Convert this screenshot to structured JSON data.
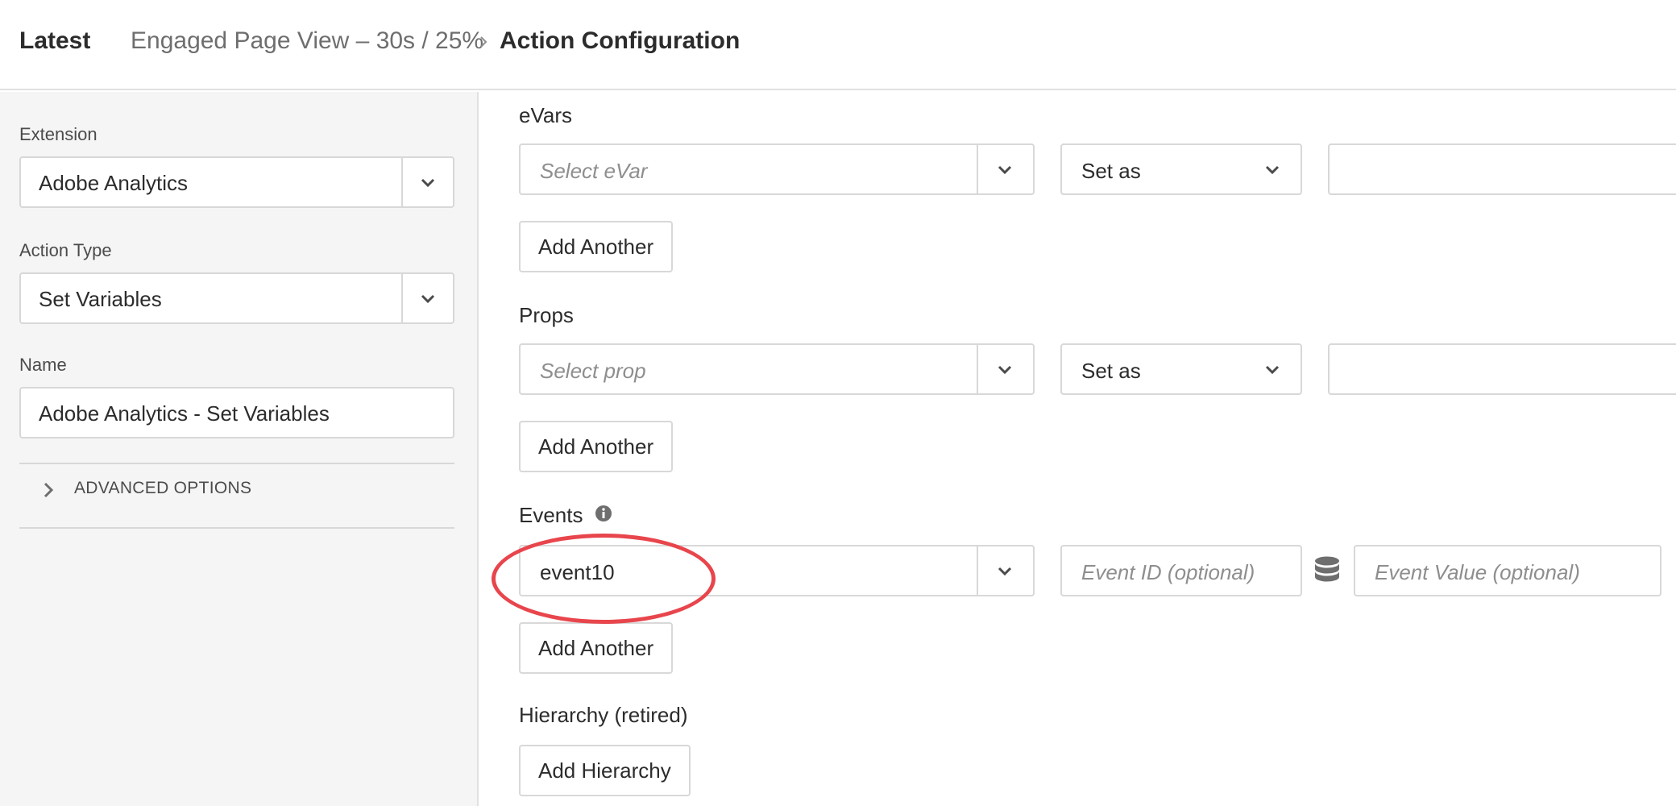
{
  "header": {
    "latest_label": "Latest",
    "breadcrumb_parent": "Engaged Page View – 30s / 25%",
    "breadcrumb_current": "Action Configuration"
  },
  "sidebar": {
    "extension_label": "Extension",
    "extension_value": "Adobe Analytics",
    "action_type_label": "Action Type",
    "action_type_value": "Set Variables",
    "name_label": "Name",
    "name_value": "Adobe Analytics - Set Variables",
    "advanced_options_label": "ADVANCED OPTIONS"
  },
  "main": {
    "evars": {
      "label": "eVars",
      "select_placeholder": "Select eVar",
      "set_as": "Set as",
      "add_another": "Add Another"
    },
    "props": {
      "label": "Props",
      "select_placeholder": "Select prop",
      "set_as": "Set as",
      "add_another": "Add Another"
    },
    "events": {
      "label": "Events",
      "selected_event": "event10",
      "event_id_placeholder": "Event ID (optional)",
      "event_value_placeholder": "Event Value (optional)",
      "add_another": "Add Another"
    },
    "hierarchy": {
      "label": "Hierarchy (retired)",
      "add_button": "Add Hierarchy"
    }
  },
  "icons": {
    "breadcrumb_separator": "chevron-right-icon",
    "dropdown": "chevron-down-icon",
    "advanced_toggle": "chevron-right-icon",
    "events_info": "info-icon",
    "data_element": "database-icon"
  },
  "colors": {
    "highlight": "#e8454c",
    "sidebar_bg": "#f5f5f5",
    "border": "#d8d8d8"
  }
}
